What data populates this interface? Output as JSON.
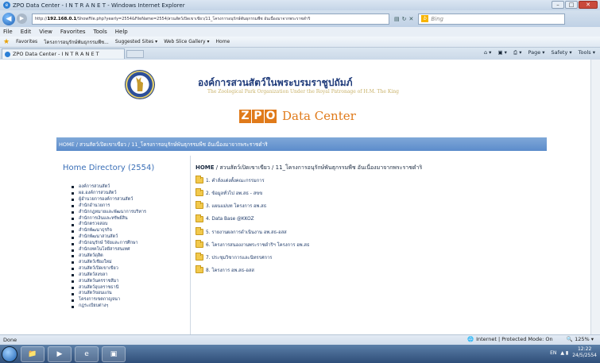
{
  "window": {
    "title": "ZPO Data Center - I N T R A N E T - Windows Internet Explorer"
  },
  "address": {
    "url_prefix": "http://",
    "url_host": "192.168.0.1",
    "url_path": "/ShowFile.php?yearly=2554&FileName=2554/สวนสัตว์เปิดเขาเขียว/11_โครงการอนุรักษ์พันธุกรรมพืช อันเนื่องมาจากพระราชดำริ",
    "search_placeholder": "Bing"
  },
  "menu": [
    "File",
    "Edit",
    "View",
    "Favorites",
    "Tools",
    "Help"
  ],
  "favorites": {
    "label": "Favorites",
    "items": [
      "โครงการอนุรักษ์พันธุกรรมพืช...",
      "Suggested Sites ▾",
      "Web Slice Gallery ▾",
      "Home"
    ]
  },
  "tab": {
    "title": "ZPO Data Center - I N T R A N E T"
  },
  "commandbar": [
    "Page ▾",
    "Safety ▾",
    "Tools ▾"
  ],
  "site": {
    "org_thai": "องค์การสวนสัตว์ในพระบรมราชูปถัมภ์",
    "org_en": "The Zoological Park Organization Under the Royal Patronage of H.M. The King",
    "brand_letters": [
      "Z",
      "P",
      "O"
    ],
    "brand_text": "Data Center",
    "top_crumb": "HOME / สวนสัตว์เปิดเขาเขียว / 11_โครงการอนุรักษ์พันธุกรรมพืช อันเนื่องมาจากพระราชดำริ"
  },
  "sidebar": {
    "title": "Home Directory (2554)",
    "items": [
      "องค์การสวนสัตว์",
      "ผอ.องค์การสวนสัตว์",
      "ผู้อำนวยการองค์การสวนสัตว์",
      "สำนักอำนวยการ",
      "สำนักกฎหมายและพัฒนาการบริหาร",
      "สำนักการเงินและทรัพย์สิน",
      "สำนักตรวจสอบ",
      "สำนักพัฒนาธุรกิจ",
      "สำนักพัฒนาสวนสัตว์",
      "สำนักอนุรักษ์ วิจัยและการศึกษา",
      "สำนักเทคโนโลยีสารสนเทศ",
      "สวนสัตว์ดุสิต",
      "สวนสัตว์เชียงใหม่",
      "สวนสัตว์เปิดเขาเขียว",
      "สวนสัตว์สงขลา",
      "สวนสัตว์นครราชสีมา",
      "สวนสัตว์อุบลราชธานี",
      "สวนสัตว์ขอนแก่น",
      "โครงการเขตกาญจนา",
      "กฎระเบียบต่างๆ"
    ]
  },
  "main": {
    "crumb_home": "HOME",
    "crumb_rest": " / สวนสัตว์เปิดเขาเขียว / 11_โครงการอนุรักษ์พันธุกรรมพืช อันเนื่องมาจากพระราชดำริ",
    "folders": [
      "1. คำสั่งแต่งตั้งคณะกรรมการ",
      "2. ข้อมูลทั่วไป อพ.สธ - สขข",
      "3. แผนแม่บท โครงการ อพ.สธ",
      "4. Data Base @KKOZ",
      "5. รายงานผลการดำเนินงาน อพ.สธ-อสส",
      "6. โครงการสนองงานพระราชดำริฯ โครงการ อพ.สธ",
      "7. ประชุมวิชาการและนิทรรศการ",
      "8. โครงการ อพ.สธ-อสส"
    ]
  },
  "status": {
    "left": "Done",
    "zone": "Internet | Protected Mode: On",
    "zoom": "125%"
  },
  "taskbar": {
    "lang": "EN",
    "time": "12:22",
    "date": "24/5/2554"
  }
}
